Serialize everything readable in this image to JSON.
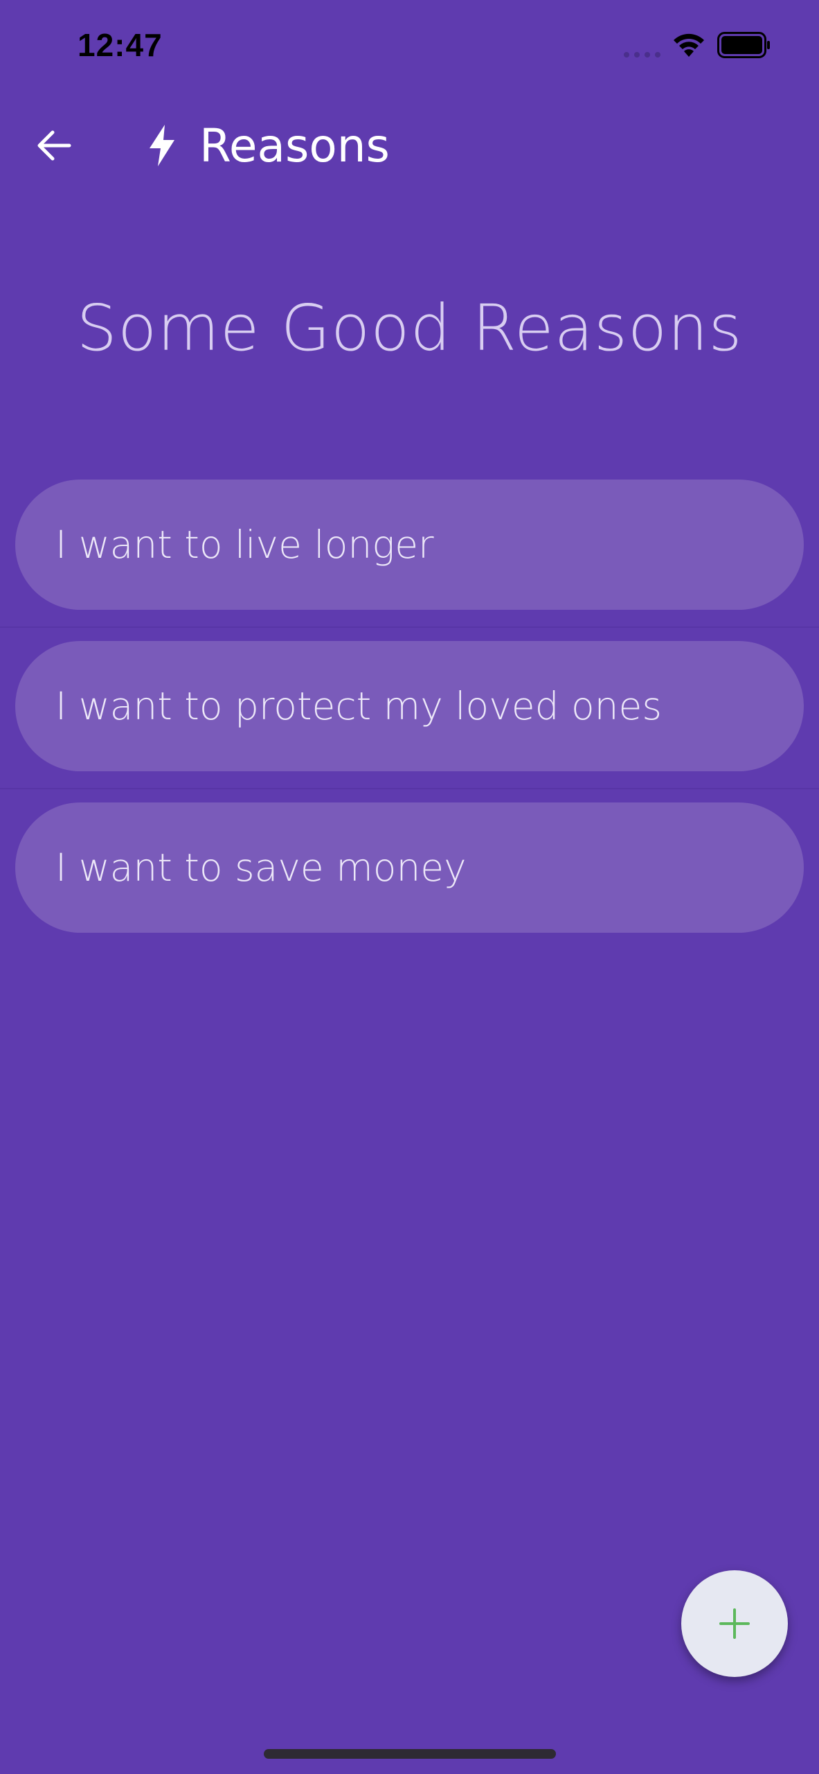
{
  "status_bar": {
    "time": "12:47",
    "icons": [
      "cellular-signal-icon",
      "wifi-icon",
      "battery-icon"
    ]
  },
  "app_bar": {
    "back_icon": "arrow-left-icon",
    "title_icon": "lightning-bolt-icon",
    "title": "Reasons"
  },
  "heading": "Some Good Reasons",
  "reasons": [
    {
      "text": "I want to live longer"
    },
    {
      "text": "I want to protect my loved ones"
    },
    {
      "text": "I want to save money"
    }
  ],
  "fab": {
    "icon": "plus-icon",
    "icon_color": "#5cb85c"
  },
  "colors": {
    "background": "#5f3baf",
    "card": "#7a5bba",
    "heading_text": "#d8cdf1",
    "fab_background": "#e6e8f2"
  }
}
